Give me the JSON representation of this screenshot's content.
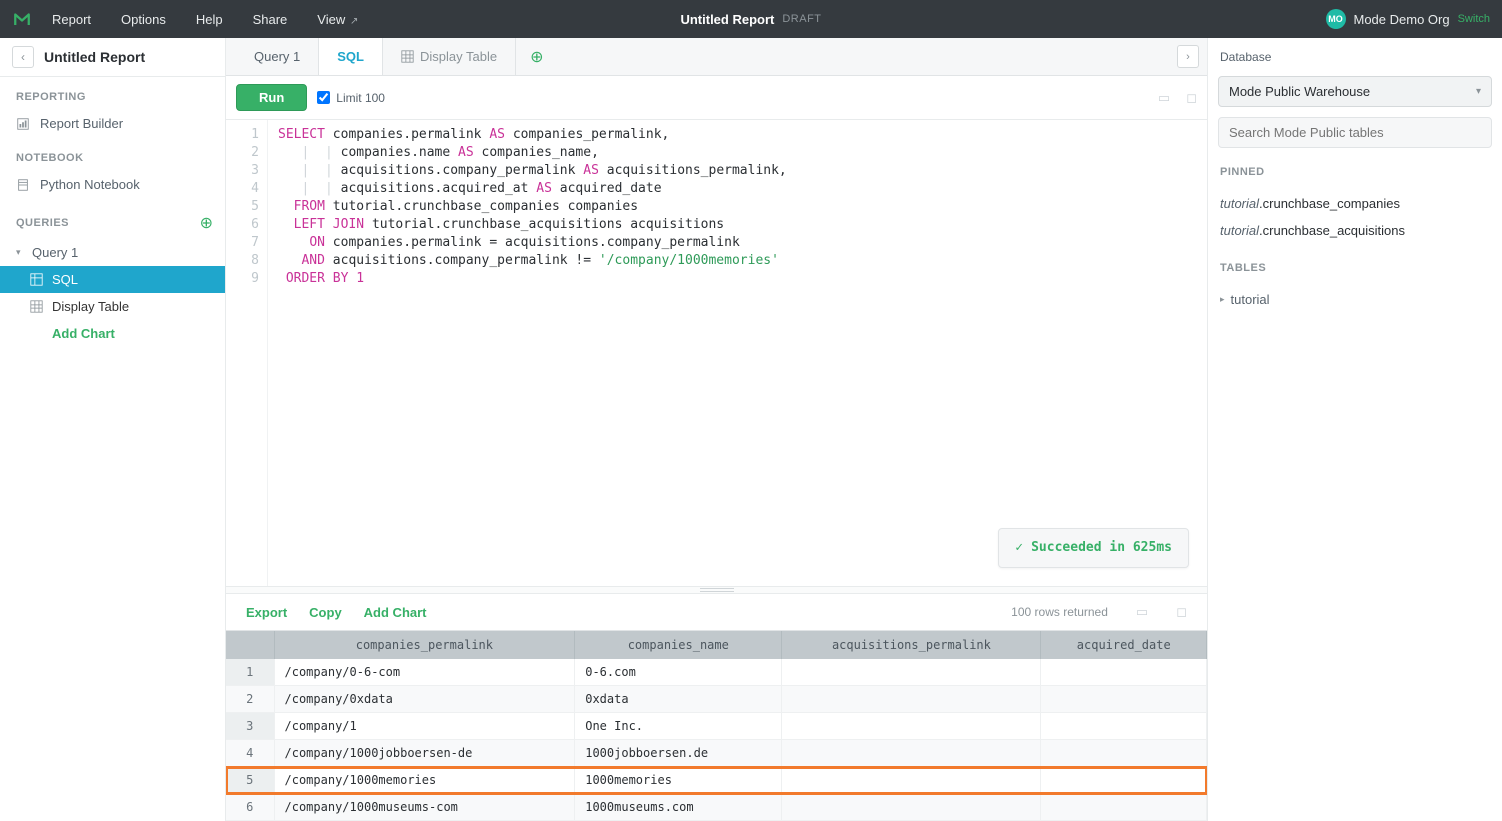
{
  "topbar": {
    "menu": [
      "Report",
      "Options",
      "Help",
      "Share",
      "View"
    ],
    "title": "Untitled Report",
    "draft": "DRAFT",
    "org": "Mode Demo Org",
    "switch": "Switch",
    "avatar": "MO"
  },
  "sidebar": {
    "report_name": "Untitled Report",
    "sections": {
      "reporting": "REPORTING",
      "notebook": "NOTEBOOK",
      "queries": "QUERIES"
    },
    "report_builder": "Report Builder",
    "python_notebook": "Python Notebook",
    "query_name": "Query 1",
    "sql": "SQL",
    "display_table": "Display Table",
    "add_chart": "Add Chart"
  },
  "tabs": {
    "query": "Query 1",
    "sql": "SQL",
    "display_table": "Display Table"
  },
  "toolbar": {
    "run": "Run",
    "limit": "Limit 100"
  },
  "sql_lines": [
    {
      "n": 1,
      "html": "<span class='kw'>SELECT</span> <span class='ident'>companies.permalink</span> <span class='kw'>AS</span> <span class='ident'>companies_permalink,</span>"
    },
    {
      "n": 2,
      "html": "   <span class='dim'>|  |</span> <span class='ident'>companies.name</span> <span class='kw'>AS</span> <span class='ident'>companies_name,</span>"
    },
    {
      "n": 3,
      "html": "   <span class='dim'>|  |</span> <span class='ident'>acquisitions.company_permalink</span> <span class='kw'>AS</span> <span class='ident'>acquisitions_permalink,</span>"
    },
    {
      "n": 4,
      "html": "   <span class='dim'>|  |</span> <span class='ident'>acquisitions.acquired_at</span> <span class='kw'>AS</span> <span class='ident'>acquired_date</span>"
    },
    {
      "n": 5,
      "html": "  <span class='kw'>FROM</span> <span class='ident'>tutorial.crunchbase_companies companies</span>"
    },
    {
      "n": 6,
      "html": "  <span class='kw'>LEFT</span> <span class='kw'>JOIN</span> <span class='ident'>tutorial.crunchbase_acquisitions acquisitions</span>"
    },
    {
      "n": 7,
      "html": "    <span class='kw'>ON</span> <span class='ident'>companies.permalink = acquisitions.company_permalink</span>"
    },
    {
      "n": 8,
      "html": "   <span class='kw'>AND</span> <span class='ident'>acquisitions.company_permalink !=</span> <span class='str'>'/company/1000memories'</span>"
    },
    {
      "n": 9,
      "html": " <span class='kw'>ORDER</span> <span class='kw'>BY</span> <span class='num'>1</span>"
    }
  ],
  "status": "Succeeded in 625ms",
  "results_bar": {
    "export": "Export",
    "copy": "Copy",
    "add_chart": "Add Chart",
    "rows_returned": "100 rows returned"
  },
  "columns": [
    "companies_permalink",
    "companies_name",
    "acquisitions_permalink",
    "acquired_date"
  ],
  "rows": [
    {
      "n": 1,
      "perm": "/company/0-6-com",
      "name": "0-6.com",
      "acq": "",
      "date": ""
    },
    {
      "n": 2,
      "perm": "/company/0xdata",
      "name": "0xdata",
      "acq": "",
      "date": ""
    },
    {
      "n": 3,
      "perm": "/company/1",
      "name": "One Inc.",
      "acq": "",
      "date": ""
    },
    {
      "n": 4,
      "perm": "/company/1000jobboersen-de",
      "name": "1000jobboersen.de",
      "acq": "",
      "date": ""
    },
    {
      "n": 5,
      "perm": "/company/1000memories",
      "name": "1000memories",
      "acq": "",
      "date": "",
      "highlight": true
    },
    {
      "n": 6,
      "perm": "/company/1000museums-com",
      "name": "1000museums.com",
      "acq": "",
      "date": ""
    }
  ],
  "rightpanel": {
    "database_label": "Database",
    "database_value": "Mode Public Warehouse",
    "search_placeholder": "Search Mode Public tables",
    "pinned_label": "PINNED",
    "pinned": [
      {
        "schema": "tutorial",
        "table": "crunchbase_companies"
      },
      {
        "schema": "tutorial",
        "table": "crunchbase_acquisitions"
      }
    ],
    "tables_label": "TABLES",
    "tables_tree": "tutorial"
  }
}
